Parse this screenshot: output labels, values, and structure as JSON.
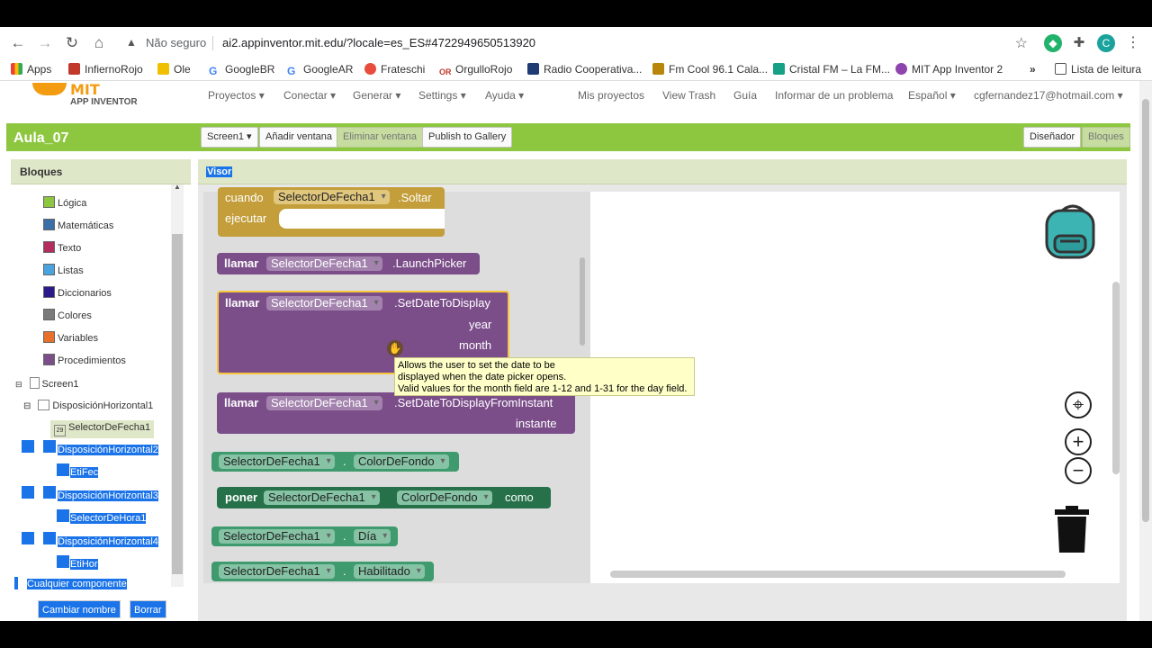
{
  "browser": {
    "insecure_label": "Não seguro",
    "url": "ai2.appinventor.mit.edu/?locale=es_ES#4722949650513920",
    "profile_initial": "C",
    "bookmarks": [
      "Apps",
      "InfiernoRojo",
      "Ole",
      "GoogleBR",
      "GoogleAR",
      "Frateschi",
      "OrgulloRojo",
      "Radio Cooperativa...",
      "Fm Cool 96.1 Cala...",
      "Cristal FM – La FM...",
      "MIT App Inventor 2"
    ],
    "reading_list": "Lista de leitura"
  },
  "appnav": {
    "logo_top": "MIT",
    "logo_bottom": "APP INVENTOR",
    "menus": [
      "Proyectos ▾",
      "Conectar ▾",
      "Generar ▾",
      "Settings ▾",
      "Ayuda ▾"
    ],
    "links": [
      "Mis proyectos",
      "View Trash",
      "Guía",
      "Informar de un problema",
      "Español ▾",
      "cgfernandez17@hotmail.com ▾"
    ]
  },
  "toolbar": {
    "project_name": "Aula_07",
    "screen_select": "Screen1 ▾",
    "add_screen": "Añadir ventana",
    "remove_screen": "Eliminar ventana",
    "publish": "Publish to Gallery",
    "designer": "Diseñador",
    "blocks": "Bloques"
  },
  "left_panel": {
    "title": "Bloques",
    "builtin": [
      {
        "label": "Lógica",
        "color": "#8dc63f"
      },
      {
        "label": "Matemáticas",
        "color": "#3b6fa8"
      },
      {
        "label": "Texto",
        "color": "#b32d5e"
      },
      {
        "label": "Listas",
        "color": "#4aa3df"
      },
      {
        "label": "Diccionarios",
        "color": "#2d1a8a"
      },
      {
        "label": "Colores",
        "color": "#7a7a7a"
      },
      {
        "label": "Variables",
        "color": "#e8702a"
      },
      {
        "label": "Procedimientos",
        "color": "#7b4e8a"
      }
    ],
    "tree": {
      "screen": "Screen1",
      "h1": "DisposiciónHorizontal1",
      "date_picker": "SelectorDeFecha1",
      "h2": "DisposiciónHorizontal2",
      "label1": "EtiFec",
      "h3": "DisposiciónHorizontal3",
      "time_picker": "SelectorDeHora1",
      "h4": "DisposiciónHorizontal4",
      "label2": "EtiHor",
      "any": "Cualquier componente"
    },
    "rename": "Cambiar nombre",
    "delete": "Borrar"
  },
  "viewer": {
    "title": "Visor",
    "blocks": {
      "when": "cuando",
      "component": "SelectorDeFecha1",
      "event": ".Soltar",
      "do": "ejecutar",
      "call": "llamar",
      "launch": ".LaunchPicker",
      "setdate": ".SetDateToDisplay",
      "year": "year",
      "month": "month",
      "setinstant": ".SetDateToDisplayFromInstant",
      "instant": "instante",
      "colorfondo": "ColorDeFondo",
      "set": "poner",
      "as": "como",
      "dia": "Día",
      "habilitado": "Habilitado"
    },
    "tooltip": [
      "Allows the user to set the date to be",
      "displayed when the date picker opens.",
      "Valid values for the month field are 1-12 and 1-31 for the day field."
    ]
  }
}
